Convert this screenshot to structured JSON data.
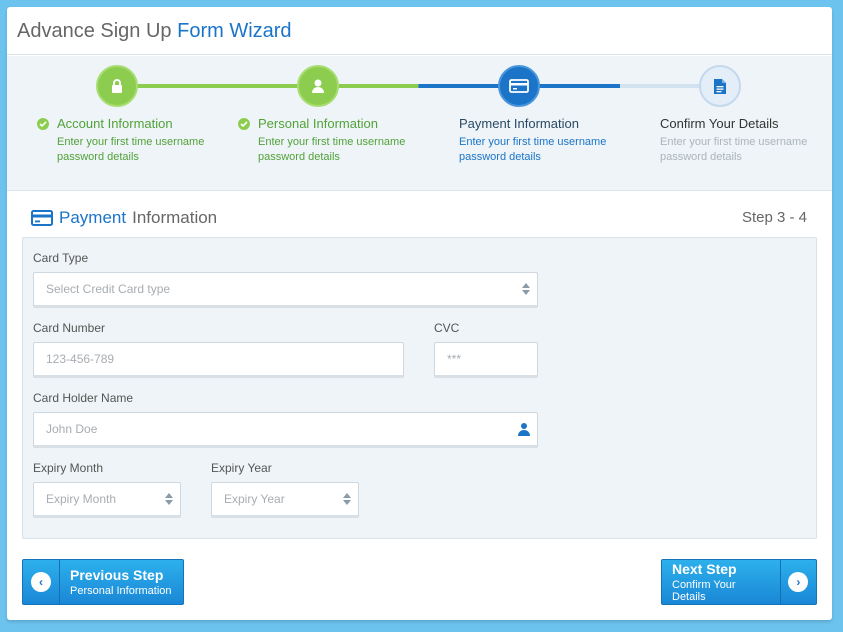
{
  "header": {
    "title_prefix": "Advance Sign Up",
    "title_accent": "Form Wizard"
  },
  "steps": [
    {
      "title": "Account Information",
      "desc_line1": "Enter your first time username",
      "desc_line2": "password details",
      "state": "done",
      "icon": "lock-icon"
    },
    {
      "title": "Personal Information",
      "desc_line1": "Enter your first time username",
      "desc_line2": "password details",
      "state": "done",
      "icon": "user-icon"
    },
    {
      "title": "Payment Information",
      "desc_line1": "Enter your first time username",
      "desc_line2": "password details",
      "state": "active",
      "icon": "credit-card-icon"
    },
    {
      "title": "Confirm Your Details",
      "desc_line1": "Enter your first time username",
      "desc_line2": "password details",
      "state": "todo",
      "icon": "document-icon"
    }
  ],
  "section": {
    "title_accent": "Payment",
    "title_rest": "Information",
    "step_count": "Step 3 - 4"
  },
  "form": {
    "card_type": {
      "label": "Card Type",
      "placeholder": "Select Credit Card type"
    },
    "card_number": {
      "label": "Card Number",
      "placeholder": "123-456-789"
    },
    "cvc": {
      "label": "CVC",
      "placeholder": "***"
    },
    "card_holder": {
      "label": "Card Holder Name",
      "placeholder": "John Doe"
    },
    "expiry_month": {
      "label": "Expiry Month",
      "placeholder": "Expiry Month"
    },
    "expiry_year": {
      "label": "Expiry Year",
      "placeholder": "Expiry Year"
    }
  },
  "buttons": {
    "previous": {
      "label": "Previous Step",
      "sub": "Personal Information"
    },
    "next": {
      "label": "Next Step",
      "sub": "Confirm Your Details"
    }
  },
  "colors": {
    "accent": "#1b74c8",
    "done": "#8ccd4f",
    "background": "#6cc3ee"
  }
}
